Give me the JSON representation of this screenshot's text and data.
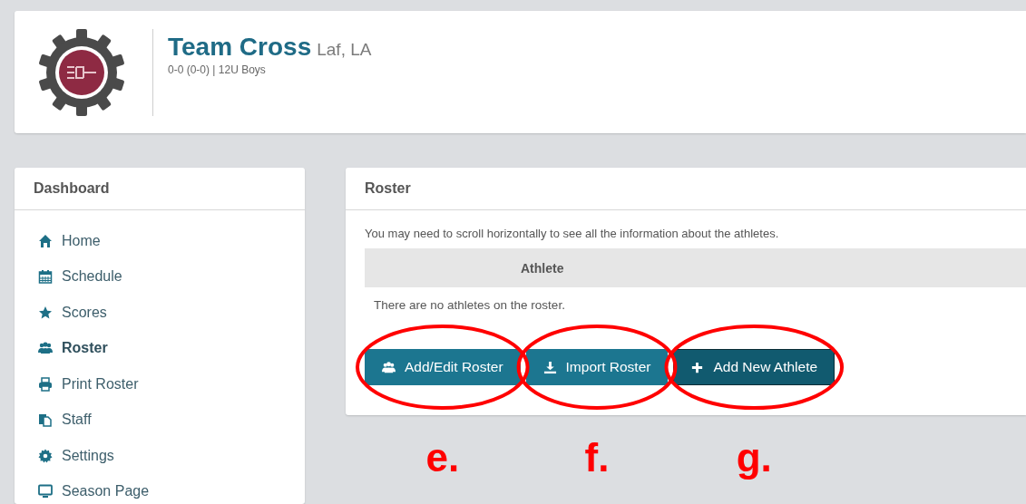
{
  "header": {
    "team_name": "Team Cross",
    "location": "Laf, LA",
    "record": "0-0 (0-0) | 12U Boys"
  },
  "sidebar": {
    "title": "Dashboard",
    "items": [
      {
        "label": "Home",
        "kind": "home",
        "selected": false
      },
      {
        "label": "Schedule",
        "kind": "calendar",
        "selected": false
      },
      {
        "label": "Scores",
        "kind": "star",
        "selected": false
      },
      {
        "label": "Roster",
        "kind": "users",
        "selected": true
      },
      {
        "label": "Print Roster",
        "kind": "print",
        "selected": false
      },
      {
        "label": "Staff",
        "kind": "copy",
        "selected": false
      },
      {
        "label": "Settings",
        "kind": "gear",
        "selected": false
      },
      {
        "label": "Season Page",
        "kind": "monitor",
        "selected": false
      }
    ]
  },
  "roster": {
    "title": "Roster",
    "note": "You may need to scroll horizontally to see all the information about the athletes.",
    "table": {
      "columns": [
        "Athlete"
      ],
      "empty_message": "There are no athletes on the roster."
    },
    "buttons": [
      {
        "label": "Add/Edit Roster",
        "kind": "users",
        "focused": false
      },
      {
        "label": "Import Roster",
        "kind": "download",
        "focused": false
      },
      {
        "label": "Add New Athlete",
        "kind": "plus",
        "focused": true
      }
    ]
  },
  "annotations": [
    {
      "label": "e."
    },
    {
      "label": "f."
    },
    {
      "label": "g."
    }
  ]
}
